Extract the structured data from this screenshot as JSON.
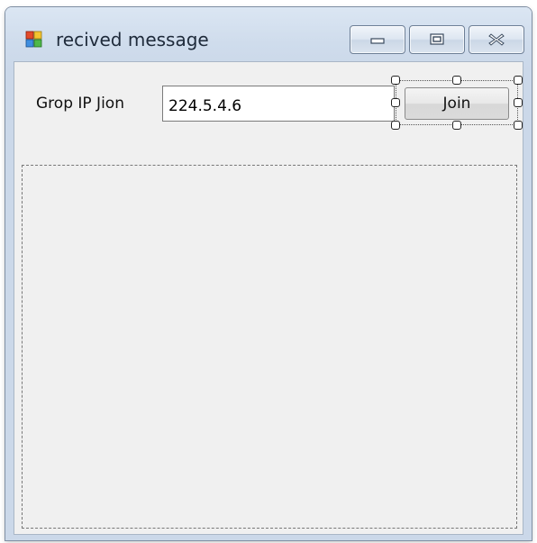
{
  "window": {
    "title": "recived message",
    "icon": "app-window-icon",
    "caption_buttons": [
      "minimize-icon",
      "maximize-icon",
      "close-icon"
    ]
  },
  "form": {
    "ip_label": "Grop IP Jion",
    "ip_value": "224.5.4.6",
    "join_label": "Join"
  },
  "colors": {
    "title_bar": "#cfdcec",
    "client_background": "#f0f0f0",
    "input_background": "#ffffff"
  }
}
